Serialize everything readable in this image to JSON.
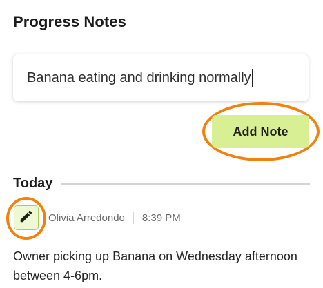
{
  "page": {
    "title": "Progress Notes"
  },
  "note_input": {
    "value": "Banana eating and drinking normally"
  },
  "actions": {
    "add_note_label": "Add Note"
  },
  "timeline": {
    "section_label": "Today",
    "notes": [
      {
        "author": "Olivia Arredondo",
        "time": "8:39 PM",
        "text": "Owner picking up Banana on Wednesday afternoon between 4-6pm.",
        "edit_icon": "pencil-icon"
      }
    ]
  },
  "colors": {
    "accent_button": "#d8ef94",
    "edit_button_bg": "#eef8d3",
    "highlight_ring": "#f0820f"
  }
}
